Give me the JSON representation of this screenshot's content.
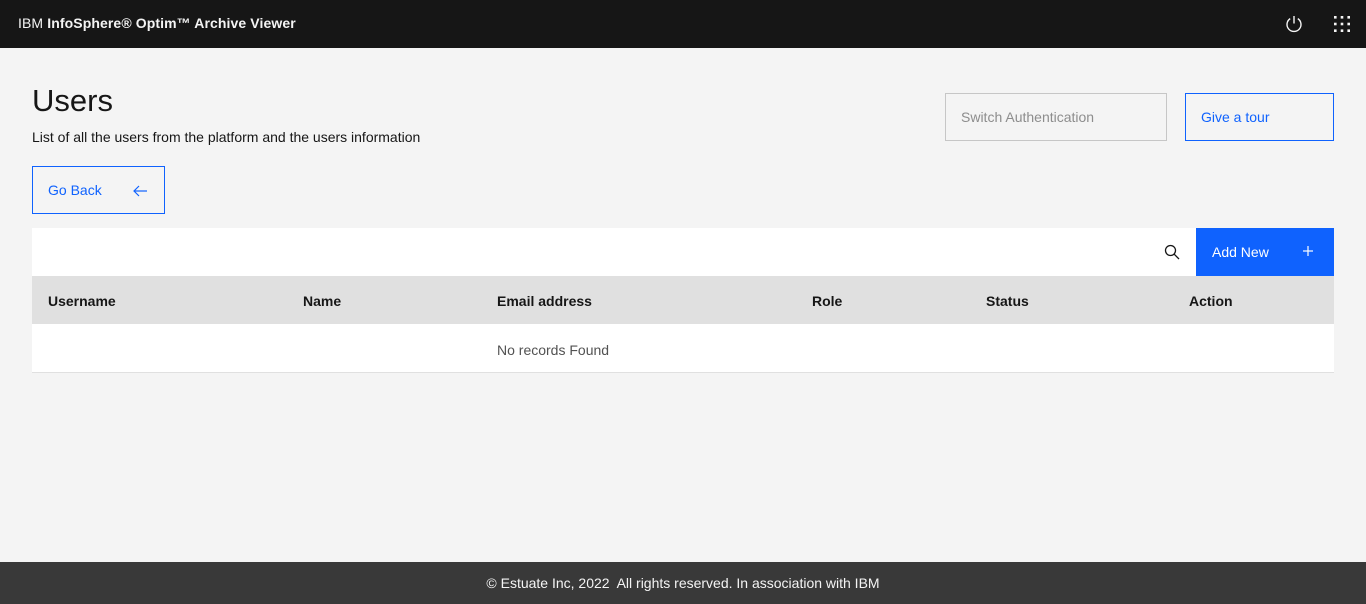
{
  "header": {
    "brand_prefix": "IBM",
    "brand_name": "InfoSphere® Optim™ Archive Viewer",
    "power_icon": "power-icon",
    "apps_icon": "app-switcher-icon"
  },
  "page": {
    "title": "Users",
    "subtitle": "List of all the users from the platform and the users information"
  },
  "actions": {
    "switch_auth": "Switch Authentication",
    "tour": "Give a tour",
    "go_back": "Go Back",
    "add_new": "Add New"
  },
  "table": {
    "columns": [
      "Username",
      "Name",
      "Email address",
      "Role",
      "Status",
      "Action"
    ],
    "empty_message": "No records Found"
  },
  "footer": {
    "text": "© Estuate Inc, 2022  All rights reserved. In association with IBM"
  },
  "colors": {
    "accent": "#0f62fe",
    "topbar": "#161616",
    "footer": "#393939",
    "background": "#f4f4f4"
  }
}
